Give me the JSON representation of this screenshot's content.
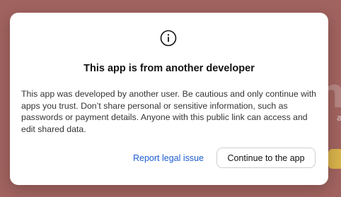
{
  "modal": {
    "icon": "info-icon",
    "title": "This app is from another developer",
    "body": "This app was developed by another user. Be cautious and only continue with apps you trust. Don’t share personal or sensitive information, such as passwords or payment details. Anyone with this public link can access and edit shared data.",
    "report_label": "Report legal issue",
    "continue_label": "Continue to the app"
  },
  "colors": {
    "backdrop": "#a1635f",
    "link": "#1d5dd1",
    "button_border": "#cfcfcf"
  }
}
